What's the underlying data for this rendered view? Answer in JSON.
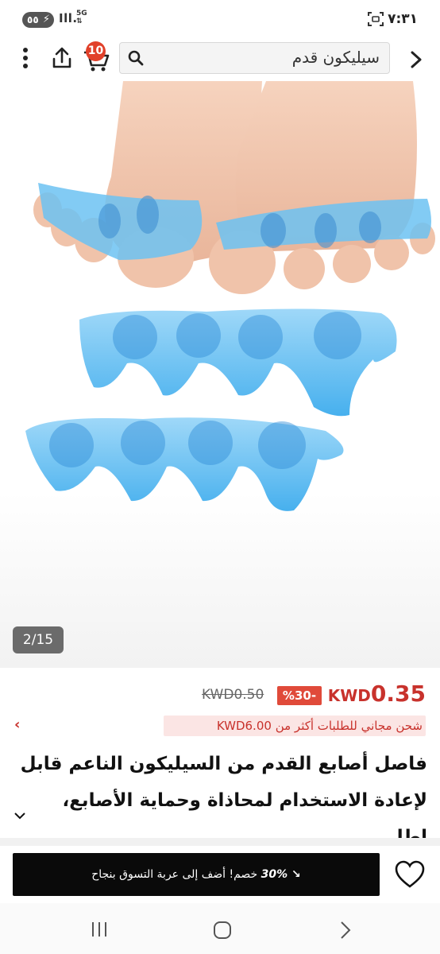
{
  "status_bar": {
    "time": "٧:٣١",
    "battery": "٥٥",
    "signal": "Ill.",
    "network": "5G"
  },
  "top_bar": {
    "search_query": "سيليكون قدم",
    "cart_count": "10",
    "icons": [
      "back-chevron-icon",
      "search-icon",
      "cart-icon",
      "share-icon",
      "more-vert-icon"
    ]
  },
  "gallery": {
    "counter": "2/15",
    "image_subject": "blue silicone toe separators"
  },
  "product": {
    "price_now_currency": "KWD",
    "price_now_value": "0.35",
    "discount": "%30-",
    "price_old": "KWD0.50",
    "shipping": "شحن مجاني للطلبات أكثر من KWD6.00",
    "title_line1": "فاصل أصابع القدم من السيليكون الناعم قابل",
    "title_line2": "لإعادة الاستخدام لمحاذاة وحماية الأصابع، إطا...",
    "accent_color": "#c8322c",
    "badge_color": "#e04a3a"
  },
  "cta": {
    "discount_lead": "30%",
    "add_to_cart_label": "خصم! أضف إلى عربة التسوق بنجاح"
  },
  "nav": {
    "icons": [
      "recent-apps-icon",
      "home-icon",
      "back-icon"
    ]
  }
}
